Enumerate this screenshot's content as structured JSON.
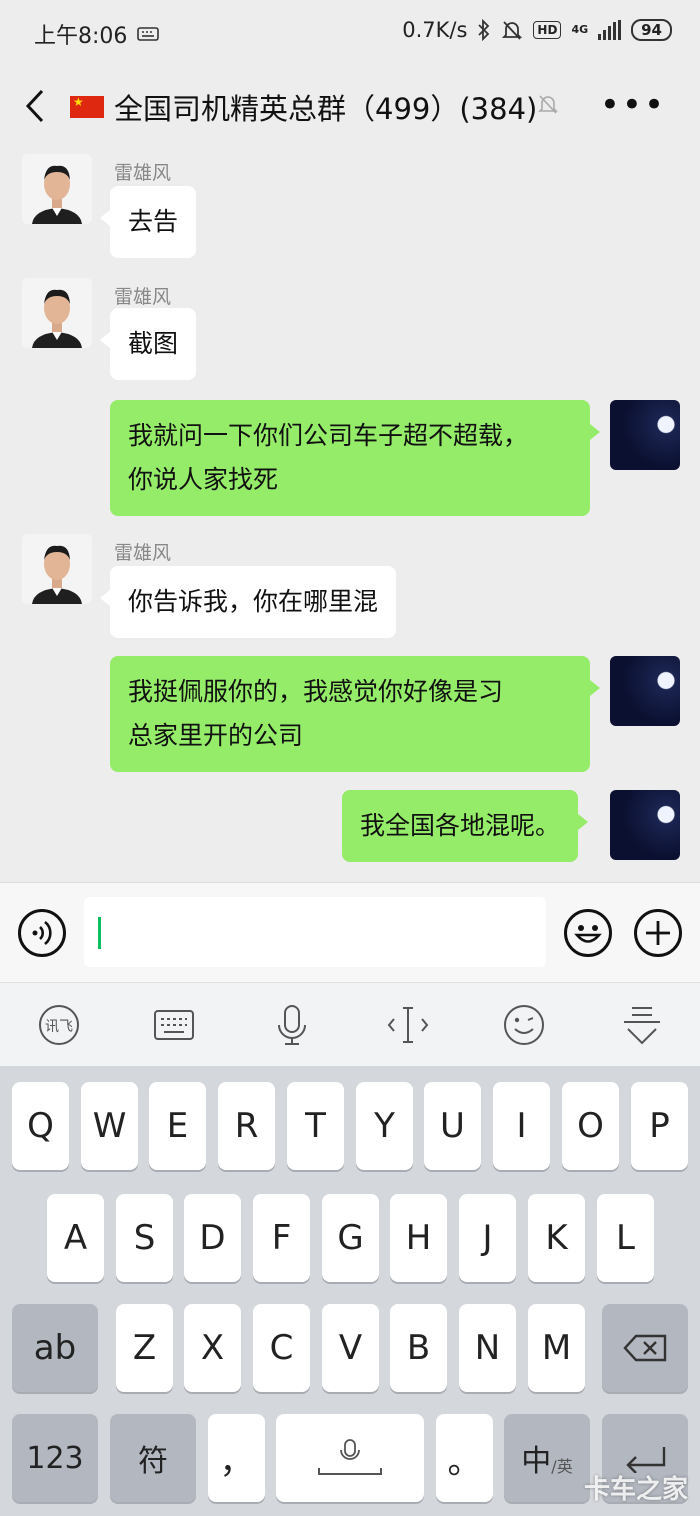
{
  "status_bar": {
    "time": "上午8:06",
    "speed": "0.7K/s",
    "hd": "HD",
    "network": "4G",
    "battery": "94"
  },
  "header": {
    "title": "全国司机精英总群（499）(384)",
    "back_icon": "back-arrow-icon",
    "mute_icon": "bell-muted-icon",
    "more_label": "•••"
  },
  "messages": [
    {
      "direction": "in",
      "sender": "雷雄风",
      "text": "去告"
    },
    {
      "direction": "in",
      "sender": "雷雄风",
      "text": "截图"
    },
    {
      "direction": "out",
      "line1": "我就问一下你们公司车子超不超载，",
      "line2": "你说人家找死"
    },
    {
      "direction": "in",
      "sender": "雷雄风",
      "text": "你告诉我，你在哪里混"
    },
    {
      "direction": "out",
      "line1": "我挺佩服你的，我感觉你好像是习",
      "line2": "总家里开的公司"
    },
    {
      "direction": "out",
      "text": "我全国各地混呢。"
    }
  ],
  "input": {
    "voice_icon": "voice-icon",
    "emoji_icon": "emoji-icon",
    "plus_icon": "plus-icon",
    "value": ""
  },
  "ime_toolbar": {
    "icons": [
      "ifly-logo-icon",
      "keyboard-icon",
      "microphone-icon",
      "cursor-icon",
      "emoticon-icon",
      "collapse-keyboard-icon"
    ]
  },
  "keyboard": {
    "row1": [
      "Q",
      "W",
      "E",
      "R",
      "T",
      "Y",
      "U",
      "I",
      "O",
      "P"
    ],
    "row2": [
      "A",
      "S",
      "D",
      "F",
      "G",
      "H",
      "J",
      "K",
      "L"
    ],
    "row3_left": "ab",
    "row3": [
      "Z",
      "X",
      "C",
      "V",
      "B",
      "N",
      "M"
    ],
    "row4": {
      "num": "123",
      "sym": "符",
      "comma": "，",
      "period": "。",
      "lang": "中",
      "lang_sub": "/英"
    }
  },
  "watermark": "卡车之家",
  "colors": {
    "outgoing_bubble": "#95ec69",
    "incoming_bubble": "#ffffff",
    "chat_bg": "#ededed",
    "caret": "#07c160"
  }
}
